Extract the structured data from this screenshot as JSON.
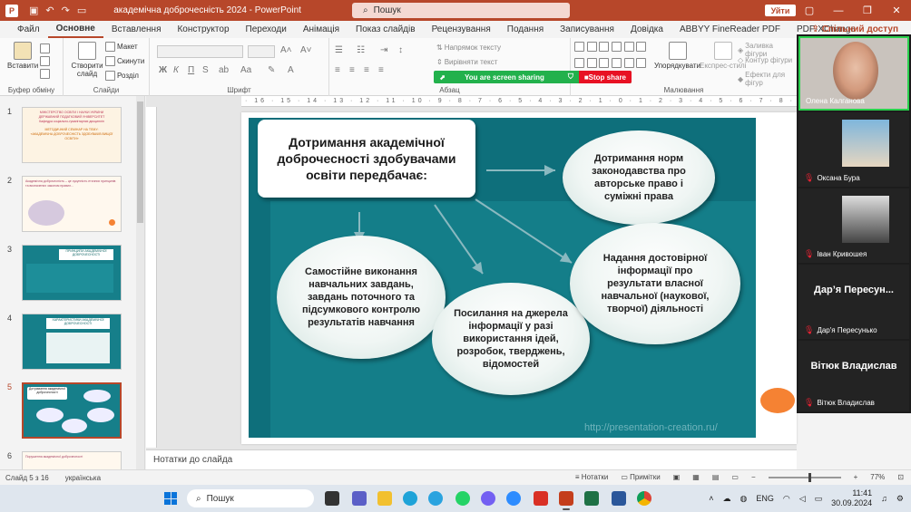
{
  "window": {
    "app_letter": "P",
    "title": "академічна доброчесність 2024  -  PowerPoint",
    "search_placeholder": "Пошук",
    "leave_label": "Уйти",
    "share_label": "Спільний доступ"
  },
  "menu": {
    "tabs": [
      "Файл",
      "Основне",
      "Вставлення",
      "Конструктор",
      "Переходи",
      "Анімація",
      "Показ слайдів",
      "Рецензування",
      "Подання",
      "Записування",
      "Довідка",
      "ABBYY FineReader PDF",
      "PDF-XChange"
    ],
    "active_tab": "Основне"
  },
  "ribbon": {
    "paste_label": "Вставити",
    "clipboard_group": "Буфер обміну",
    "new_slide_label": "Створити слайд",
    "layout_label": "Макет",
    "reset_label": "Скинути",
    "section_label": "Розділ",
    "slides_group": "Слайди",
    "font_group": "Шрифт",
    "paragraph_group": "Абзац",
    "text_direction_label": "Напрямок тексту",
    "align_text_label": "Вирівняти текст",
    "arrange_label": "Упорядкувати",
    "quick_styles_label": "Експрес-стилі",
    "shape_fill_label": "Заливка фігури",
    "shape_outline_label": "Контур фігури",
    "shape_effects_label": "Ефекти для фігур",
    "drawing_group": "Малювання"
  },
  "screen_share": {
    "text": "You are screen sharing",
    "stop_label": "Stop share"
  },
  "thumbnails": [
    {
      "num": "1",
      "lines": [
        "МІНІСТЕРСТВО ОСВІТИ І НАУКИ УКРАЇНИ",
        "ДЕРЖАВНИЙ ПОДАТКОВИЙ УНІВЕРСИТЕТ",
        "Кафедра соціально-гуманітарних дисциплін",
        "МЕТОДИЧНИЙ СЕМІНАР НА ТЕМУ:",
        "«АКАДЕМІЧНА ДОБРОЧЕСНІСТЬ ЗДОБУВАЧІВ ВИЩОЇ ОСВІТИ»"
      ]
    },
    {
      "num": "2",
      "lines": [
        "Академічна доброчесність – це сукупність етичних принципів та визначених законом правил..."
      ]
    },
    {
      "num": "3",
      "lines": [
        "ПРИНЦИПИ АКАДЕМІЧНОЇ ДОБРОЧЕСНОСТІ"
      ]
    },
    {
      "num": "4",
      "lines": [
        "ХАРАКТЕРИСТИКИ АКАДЕМІЧНОЇ ДОБРОЧЕСНОСТІ"
      ]
    },
    {
      "num": "5",
      "lines": [
        "Дотримання академічної доброчесності"
      ]
    },
    {
      "num": "6",
      "lines": [
        "Порушення академічної доброчесності"
      ]
    }
  ],
  "selected_thumbnail": "5",
  "slide": {
    "heading": "Дотримання академічної доброчесності здобувачами освіти передбачає:",
    "oval_law": "Дотримання норм законодавства про авторське право і суміжні права",
    "oval_self": "Самостійне виконання навчальних завдань, завдань поточного та підсумкового контролю результатів навчання",
    "oval_refs": "Посилання на джерела інформації у разі використання ідей, розробок, тверджень, відомостей",
    "oval_info": "Надання достовірної інформації про результати власної навчальної (наукової, творчої) діяльності",
    "url": "http://presentation-creation.ru/"
  },
  "notes": {
    "placeholder": "Нотатки до слайда"
  },
  "participants": [
    {
      "name": "Олена Калганова",
      "type": "video"
    },
    {
      "name": "Оксана Бура",
      "type": "avatar"
    },
    {
      "name": "Іван Кривошея",
      "type": "avatar"
    },
    {
      "name": "Дар'я Пересунько",
      "type": "text",
      "big": "Дар’я Пересун..."
    },
    {
      "name": "Вітюк Владислав",
      "type": "text",
      "big": "Вітюк Владислав"
    }
  ],
  "statusbar": {
    "slide_info": "Слайд 5 з 16",
    "language": "українська",
    "notes_label": "Нотатки",
    "comments_label": "Примітки",
    "zoom": "77%"
  },
  "taskbar": {
    "search_placeholder": "Пошук",
    "language": "ENG",
    "time": "11:41",
    "date": "30.09.2024"
  },
  "colors": {
    "ppt_brand": "#b7472a",
    "slide_bg": "#0e6f7b",
    "share_green": "#22b14c",
    "stop_red": "#e81123",
    "orange": "#f58233"
  }
}
